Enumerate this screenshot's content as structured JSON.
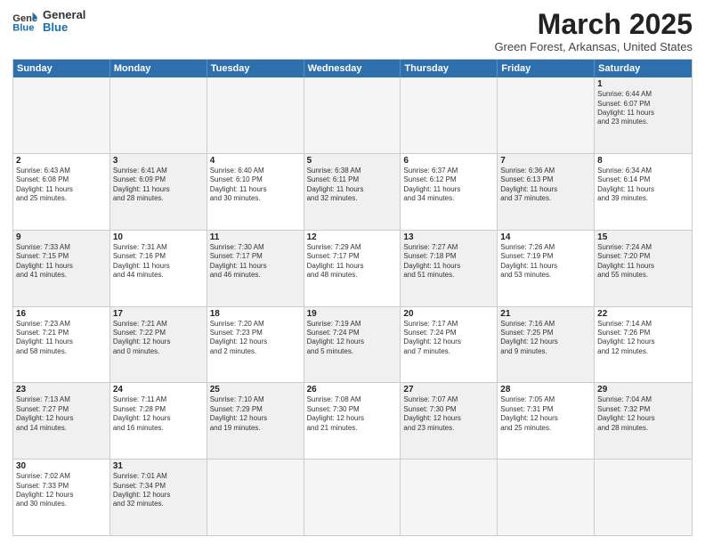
{
  "header": {
    "logo_general": "General",
    "logo_blue": "Blue",
    "month_title": "March 2025",
    "location": "Green Forest, Arkansas, United States"
  },
  "weekdays": [
    "Sunday",
    "Monday",
    "Tuesday",
    "Wednesday",
    "Thursday",
    "Friday",
    "Saturday"
  ],
  "rows": [
    [
      {
        "day": "",
        "text": "",
        "empty": true
      },
      {
        "day": "",
        "text": "",
        "empty": true
      },
      {
        "day": "",
        "text": "",
        "empty": true
      },
      {
        "day": "",
        "text": "",
        "empty": true
      },
      {
        "day": "",
        "text": "",
        "empty": true
      },
      {
        "day": "",
        "text": "",
        "empty": true
      },
      {
        "day": "1",
        "text": "Sunrise: 6:44 AM\nSunset: 6:07 PM\nDaylight: 11 hours\nand 23 minutes.",
        "shaded": true
      }
    ],
    [
      {
        "day": "2",
        "text": "Sunrise: 6:43 AM\nSunset: 6:08 PM\nDaylight: 11 hours\nand 25 minutes."
      },
      {
        "day": "3",
        "text": "Sunrise: 6:41 AM\nSunset: 6:09 PM\nDaylight: 11 hours\nand 28 minutes.",
        "shaded": true
      },
      {
        "day": "4",
        "text": "Sunrise: 6:40 AM\nSunset: 6:10 PM\nDaylight: 11 hours\nand 30 minutes."
      },
      {
        "day": "5",
        "text": "Sunrise: 6:38 AM\nSunset: 6:11 PM\nDaylight: 11 hours\nand 32 minutes.",
        "shaded": true
      },
      {
        "day": "6",
        "text": "Sunrise: 6:37 AM\nSunset: 6:12 PM\nDaylight: 11 hours\nand 34 minutes."
      },
      {
        "day": "7",
        "text": "Sunrise: 6:36 AM\nSunset: 6:13 PM\nDaylight: 11 hours\nand 37 minutes.",
        "shaded": true
      },
      {
        "day": "8",
        "text": "Sunrise: 6:34 AM\nSunset: 6:14 PM\nDaylight: 11 hours\nand 39 minutes."
      }
    ],
    [
      {
        "day": "9",
        "text": "Sunrise: 7:33 AM\nSunset: 7:15 PM\nDaylight: 11 hours\nand 41 minutes.",
        "shaded": true
      },
      {
        "day": "10",
        "text": "Sunrise: 7:31 AM\nSunset: 7:16 PM\nDaylight: 11 hours\nand 44 minutes."
      },
      {
        "day": "11",
        "text": "Sunrise: 7:30 AM\nSunset: 7:17 PM\nDaylight: 11 hours\nand 46 minutes.",
        "shaded": true
      },
      {
        "day": "12",
        "text": "Sunrise: 7:29 AM\nSunset: 7:17 PM\nDaylight: 11 hours\nand 48 minutes."
      },
      {
        "day": "13",
        "text": "Sunrise: 7:27 AM\nSunset: 7:18 PM\nDaylight: 11 hours\nand 51 minutes.",
        "shaded": true
      },
      {
        "day": "14",
        "text": "Sunrise: 7:26 AM\nSunset: 7:19 PM\nDaylight: 11 hours\nand 53 minutes."
      },
      {
        "day": "15",
        "text": "Sunrise: 7:24 AM\nSunset: 7:20 PM\nDaylight: 11 hours\nand 55 minutes.",
        "shaded": true
      }
    ],
    [
      {
        "day": "16",
        "text": "Sunrise: 7:23 AM\nSunset: 7:21 PM\nDaylight: 11 hours\nand 58 minutes."
      },
      {
        "day": "17",
        "text": "Sunrise: 7:21 AM\nSunset: 7:22 PM\nDaylight: 12 hours\nand 0 minutes.",
        "shaded": true
      },
      {
        "day": "18",
        "text": "Sunrise: 7:20 AM\nSunset: 7:23 PM\nDaylight: 12 hours\nand 2 minutes."
      },
      {
        "day": "19",
        "text": "Sunrise: 7:19 AM\nSunset: 7:24 PM\nDaylight: 12 hours\nand 5 minutes.",
        "shaded": true
      },
      {
        "day": "20",
        "text": "Sunrise: 7:17 AM\nSunset: 7:24 PM\nDaylight: 12 hours\nand 7 minutes."
      },
      {
        "day": "21",
        "text": "Sunrise: 7:16 AM\nSunset: 7:25 PM\nDaylight: 12 hours\nand 9 minutes.",
        "shaded": true
      },
      {
        "day": "22",
        "text": "Sunrise: 7:14 AM\nSunset: 7:26 PM\nDaylight: 12 hours\nand 12 minutes."
      }
    ],
    [
      {
        "day": "23",
        "text": "Sunrise: 7:13 AM\nSunset: 7:27 PM\nDaylight: 12 hours\nand 14 minutes.",
        "shaded": true
      },
      {
        "day": "24",
        "text": "Sunrise: 7:11 AM\nSunset: 7:28 PM\nDaylight: 12 hours\nand 16 minutes."
      },
      {
        "day": "25",
        "text": "Sunrise: 7:10 AM\nSunset: 7:29 PM\nDaylight: 12 hours\nand 19 minutes.",
        "shaded": true
      },
      {
        "day": "26",
        "text": "Sunrise: 7:08 AM\nSunset: 7:30 PM\nDaylight: 12 hours\nand 21 minutes."
      },
      {
        "day": "27",
        "text": "Sunrise: 7:07 AM\nSunset: 7:30 PM\nDaylight: 12 hours\nand 23 minutes.",
        "shaded": true
      },
      {
        "day": "28",
        "text": "Sunrise: 7:05 AM\nSunset: 7:31 PM\nDaylight: 12 hours\nand 25 minutes."
      },
      {
        "day": "29",
        "text": "Sunrise: 7:04 AM\nSunset: 7:32 PM\nDaylight: 12 hours\nand 28 minutes.",
        "shaded": true
      }
    ],
    [
      {
        "day": "30",
        "text": "Sunrise: 7:02 AM\nSunset: 7:33 PM\nDaylight: 12 hours\nand 30 minutes."
      },
      {
        "day": "31",
        "text": "Sunrise: 7:01 AM\nSunset: 7:34 PM\nDaylight: 12 hours\nand 32 minutes.",
        "shaded": true
      },
      {
        "day": "",
        "text": "",
        "empty": true
      },
      {
        "day": "",
        "text": "",
        "empty": true
      },
      {
        "day": "",
        "text": "",
        "empty": true
      },
      {
        "day": "",
        "text": "",
        "empty": true
      },
      {
        "day": "",
        "text": "",
        "empty": true
      }
    ]
  ]
}
